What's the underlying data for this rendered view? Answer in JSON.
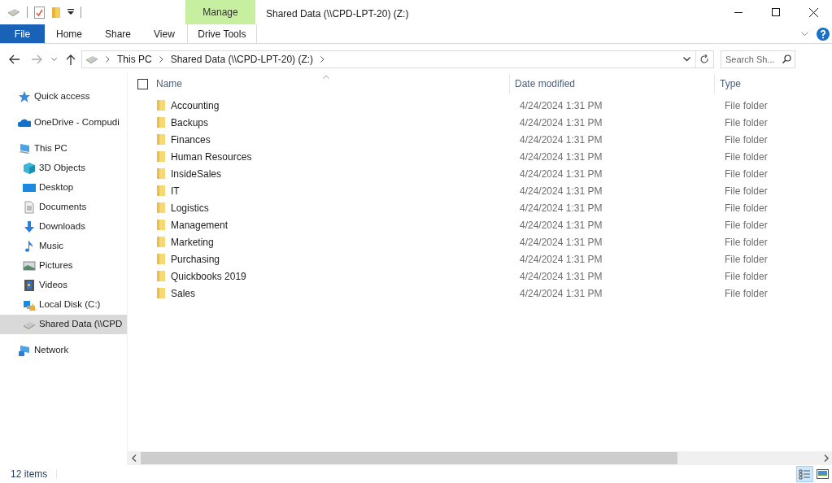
{
  "window": {
    "title": "Shared Data (\\\\CPD-LPT-20) (Z:)",
    "context_tab": "Manage"
  },
  "ribbon_tabs": [
    {
      "label": "File",
      "kind": "file",
      "selected": false
    },
    {
      "label": "Home",
      "kind": "normal",
      "selected": false
    },
    {
      "label": "Share",
      "kind": "normal",
      "selected": false
    },
    {
      "label": "View",
      "kind": "normal",
      "selected": false
    },
    {
      "label": "Drive Tools",
      "kind": "context",
      "selected": false
    }
  ],
  "address": {
    "crumbs": [
      "This PC",
      "Shared Data (\\\\CPD-LPT-20) (Z:)"
    ]
  },
  "search": {
    "placeholder": "Search Sh..."
  },
  "sidebar": {
    "items": [
      {
        "label": "Quick access",
        "selected": false
      },
      {
        "label": "OneDrive - Compudi",
        "selected": false
      },
      {
        "label": "This PC",
        "selected": false,
        "children": [
          {
            "label": "3D Objects",
            "selected": false
          },
          {
            "label": "Desktop",
            "selected": false
          },
          {
            "label": "Documents",
            "selected": false
          },
          {
            "label": "Downloads",
            "selected": false
          },
          {
            "label": "Music",
            "selected": false
          },
          {
            "label": "Pictures",
            "selected": false
          },
          {
            "label": "Videos",
            "selected": false
          },
          {
            "label": "Local Disk (C:)",
            "selected": false
          },
          {
            "label": "Shared Data (\\\\CPD",
            "selected": true
          }
        ]
      },
      {
        "label": "Network",
        "selected": false
      }
    ]
  },
  "table": {
    "select_all": {
      "checked": false
    },
    "columns": [
      "Name",
      "Date modified",
      "Type"
    ],
    "rows": [
      {
        "name": "Accounting",
        "date": "4/24/2024 1:31 PM",
        "type": "File folder"
      },
      {
        "name": "Backups",
        "date": "4/24/2024 1:31 PM",
        "type": "File folder"
      },
      {
        "name": "Finances",
        "date": "4/24/2024 1:31 PM",
        "type": "File folder"
      },
      {
        "name": "Human Resources",
        "date": "4/24/2024 1:31 PM",
        "type": "File folder"
      },
      {
        "name": "InsideSales",
        "date": "4/24/2024 1:31 PM",
        "type": "File folder"
      },
      {
        "name": "IT",
        "date": "4/24/2024 1:31 PM",
        "type": "File folder"
      },
      {
        "name": "Logistics",
        "date": "4/24/2024 1:31 PM",
        "type": "File folder"
      },
      {
        "name": "Management",
        "date": "4/24/2024 1:31 PM",
        "type": "File folder"
      },
      {
        "name": "Marketing",
        "date": "4/24/2024 1:31 PM",
        "type": "File folder"
      },
      {
        "name": "Purchasing",
        "date": "4/24/2024 1:31 PM",
        "type": "File folder"
      },
      {
        "name": "Quickbooks 2019",
        "date": "4/24/2024 1:31 PM",
        "type": "File folder"
      },
      {
        "name": "Sales",
        "date": "4/24/2024 1:31 PM",
        "type": "File folder"
      }
    ]
  },
  "status_bar": {
    "text": "12 items"
  }
}
